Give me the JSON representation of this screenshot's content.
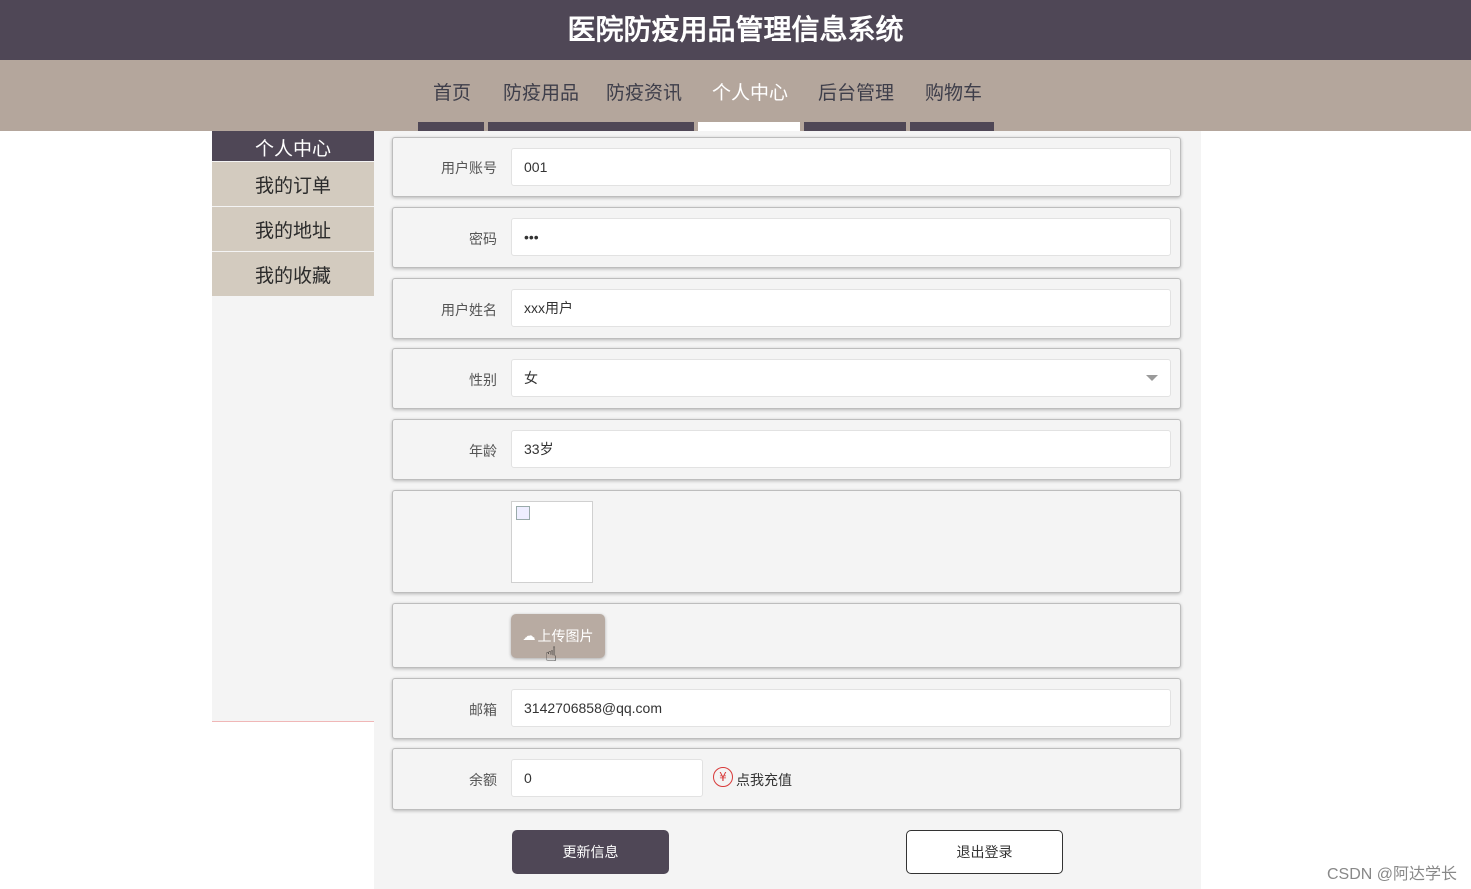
{
  "header": {
    "title": "医院防疫用品管理信息系统"
  },
  "nav": {
    "items": [
      {
        "label": "首页"
      },
      {
        "label": "防疫用品"
      },
      {
        "label": "防疫资讯"
      },
      {
        "label": "个人中心",
        "active": true
      },
      {
        "label": "后台管理"
      },
      {
        "label": "购物车"
      }
    ]
  },
  "sidebar": {
    "items": [
      {
        "label": "个人中心",
        "active": true
      },
      {
        "label": "我的订单"
      },
      {
        "label": "我的地址"
      },
      {
        "label": "我的收藏"
      }
    ]
  },
  "form": {
    "account": {
      "label": "用户账号",
      "value": "001"
    },
    "password": {
      "label": "密码",
      "value": "•••"
    },
    "name": {
      "label": "用户姓名",
      "value": "xxx用户"
    },
    "gender": {
      "label": "性别",
      "value": "女"
    },
    "age": {
      "label": "年龄",
      "value": "33岁"
    },
    "upload": {
      "label": "上传图片"
    },
    "email": {
      "label": "邮箱",
      "value": "3142706858@qq.com"
    },
    "balance": {
      "label": "余额",
      "value": "0",
      "recharge": "点我充值"
    }
  },
  "actions": {
    "update": "更新信息",
    "logout": "退出登录"
  },
  "watermark": "CSDN @阿达学长",
  "colors": {
    "primary": "#4f4756",
    "nav_bg": "#b4a69c",
    "side_item": "#d3cbbf"
  }
}
